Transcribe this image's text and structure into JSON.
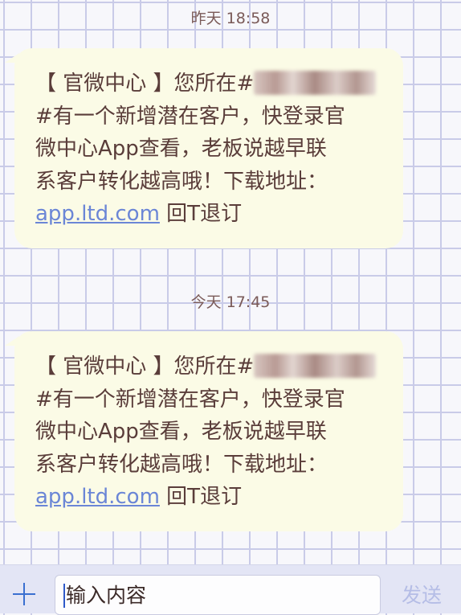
{
  "messages": [
    {
      "timestamp": "昨天 18:58",
      "lines": [
        "【 官微中心 】您所在#",
        "#有一个新增潜在客户，快登录官",
        "微中心App查看，老板说越早联",
        "系客户转化越高哦！下载地址："
      ],
      "link": "app.ltd.com",
      "suffix": " 回T退订"
    },
    {
      "timestamp": "今天 17:45",
      "lines": [
        "【 官微中心 】您所在#",
        "#有一个新增潜在客户，快登录官",
        "微中心App查看，老板说越早联",
        "系客户转化越高哦！下载地址："
      ],
      "link": "app.ltd.com",
      "suffix": " 回T退订"
    }
  ],
  "composer": {
    "input_text": "输入内容",
    "send_label": "发送",
    "plus_icon": "plus-icon"
  }
}
